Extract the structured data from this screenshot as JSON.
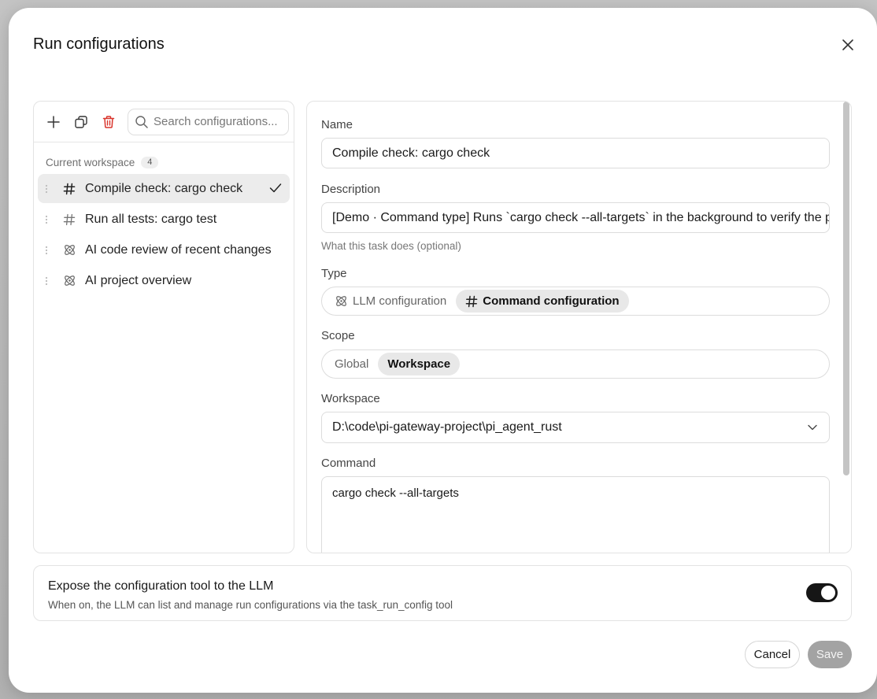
{
  "dialog": {
    "title": "Run configurations"
  },
  "sidebar": {
    "search_placeholder": "Search configurations...",
    "group_label": "Current workspace",
    "group_count": "4",
    "items": [
      {
        "label": "Compile check: cargo check",
        "type": "command",
        "selected": true
      },
      {
        "label": "Run all tests: cargo test",
        "type": "command",
        "selected": false
      },
      {
        "label": "AI code review of recent changes",
        "type": "llm",
        "selected": false
      },
      {
        "label": "AI project overview",
        "type": "llm",
        "selected": false
      }
    ]
  },
  "form": {
    "name_label": "Name",
    "name_value": "Compile check: cargo check",
    "description_label": "Description",
    "description_value": "[Demo · Command type] Runs `cargo check --all-targets` in the background to verify the project compiles",
    "description_help": "What this task does (optional)",
    "type_label": "Type",
    "type_options": [
      "LLM configuration",
      "Command configuration"
    ],
    "type_selected": "Command configuration",
    "scope_label": "Scope",
    "scope_options": [
      "Global",
      "Workspace"
    ],
    "scope_selected": "Workspace",
    "workspace_label": "Workspace",
    "workspace_value": "D:\\code\\pi-gateway-project\\pi_agent_rust",
    "command_label": "Command",
    "command_value": "cargo check --all-targets"
  },
  "expose": {
    "title": "Expose the configuration tool to the LLM",
    "description": "When on, the LLM can list and manage run configurations via the task_run_config tool",
    "enabled": true
  },
  "footer": {
    "cancel_label": "Cancel",
    "save_label": "Save"
  },
  "colors": {
    "accent_delete": "#d9342b",
    "toggle_on": "#161616",
    "save_disabled": "#a3a3a3"
  }
}
